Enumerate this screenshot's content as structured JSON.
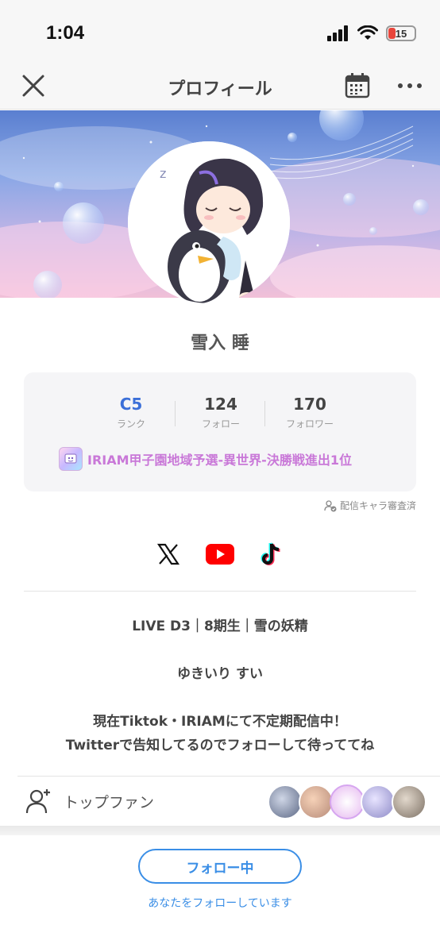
{
  "status_bar": {
    "time": "1:04",
    "battery": "15"
  },
  "nav": {
    "title": "プロフィール"
  },
  "profile": {
    "name": "雪入 睡"
  },
  "stats": {
    "rank_value": "C5",
    "rank_label": "ランク",
    "follow_value": "124",
    "follow_label": "フォロー",
    "follower_value": "170",
    "follower_label": "フォロワー"
  },
  "achievement": {
    "text": "IRIAM甲子園地域予選-異世界-決勝戦進出1位"
  },
  "review_note": "配信キャラ審査済",
  "social": [
    "x-icon",
    "youtube-icon",
    "tiktok-icon"
  ],
  "bio": {
    "line1": "LIVE D3｜8期生｜雪の妖精",
    "line2": "ゆきいり すい",
    "line3": "現在Tiktok・IRIAMにて不定期配信中！",
    "line4": "Twitterで告知してるのでフォローして待っててね"
  },
  "fans": {
    "label": "トップファン"
  },
  "bottom": {
    "follow_button": "フォロー中",
    "follows_you": "あなたをフォローしています"
  },
  "colors": {
    "accent": "#3a8ee6",
    "rank": "#3b6fd8",
    "achievement": "#c978d8"
  }
}
